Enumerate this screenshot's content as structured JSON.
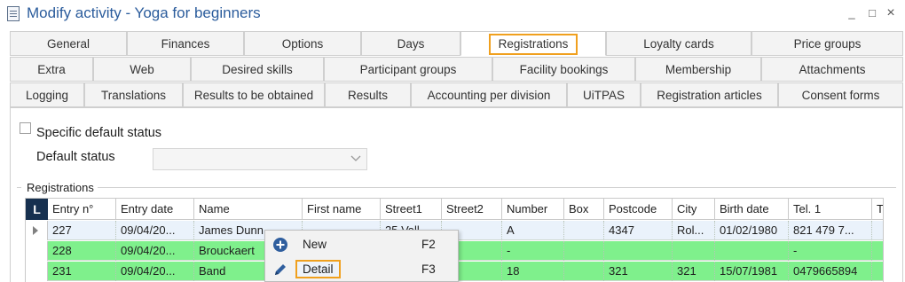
{
  "window": {
    "title": "Modify activity - Yoga for beginners",
    "controls": {
      "minimize": "_",
      "maximize": "□",
      "close": "×"
    }
  },
  "tabs": {
    "row1": [
      "General",
      "Finances",
      "Options",
      "Days",
      "Registrations",
      "Loyalty cards",
      "Price groups"
    ],
    "row2": [
      "Extra",
      "Web",
      "Desired skills",
      "Participant groups",
      "Facility bookings",
      "Membership",
      "Attachments"
    ],
    "row3": [
      "Logging",
      "Translations",
      "Results to be obtained",
      "Results",
      "Accounting per division",
      "UiTPAS",
      "Registration articles",
      "Consent forms"
    ],
    "active": "Registrations"
  },
  "form": {
    "specific_default_status": {
      "label": "Specific default status",
      "checked": false
    },
    "default_status": {
      "label": "Default status",
      "value": ""
    }
  },
  "registrations": {
    "group_label": "Registrations",
    "badge": "L",
    "columns": [
      "Entry n°",
      "Entry date",
      "Name",
      "First name",
      "Street1",
      "Street2",
      "Number",
      "Box",
      "Postcode",
      "City",
      "Birth date",
      "Tel. 1",
      "T"
    ],
    "rows": [
      {
        "style": "selected",
        "cells": [
          "227",
          "09/04/20...",
          "James Dunn",
          "",
          "25 Vall...",
          "",
          "A",
          "",
          "4347",
          "Rol...",
          "01/02/1980",
          "821 479 7...",
          ""
        ]
      },
      {
        "style": "green",
        "cells": [
          "228",
          "09/04/20...",
          "Brouckaert",
          "",
          "",
          "",
          "-",
          "",
          "",
          "",
          "",
          "-",
          ""
        ]
      },
      {
        "style": "green",
        "cells": [
          "231",
          "09/04/20...",
          "Band",
          "",
          "",
          "",
          "18",
          "",
          "321",
          "321",
          "15/07/1981",
          "0479665894",
          ""
        ]
      }
    ]
  },
  "context_menu": {
    "items": [
      {
        "label": "New",
        "shortcut": "F2",
        "icon": "plus-circle-icon"
      },
      {
        "label": "Detail",
        "shortcut": "F3",
        "icon": "pencil-icon",
        "highlighted": true
      }
    ]
  },
  "colors": {
    "title": "#2b5c9c",
    "highlight_border": "#f0a01e",
    "green_row": "#7ff08c",
    "badge_bg": "#16304f",
    "icon_blue": "#2f5e9e"
  }
}
